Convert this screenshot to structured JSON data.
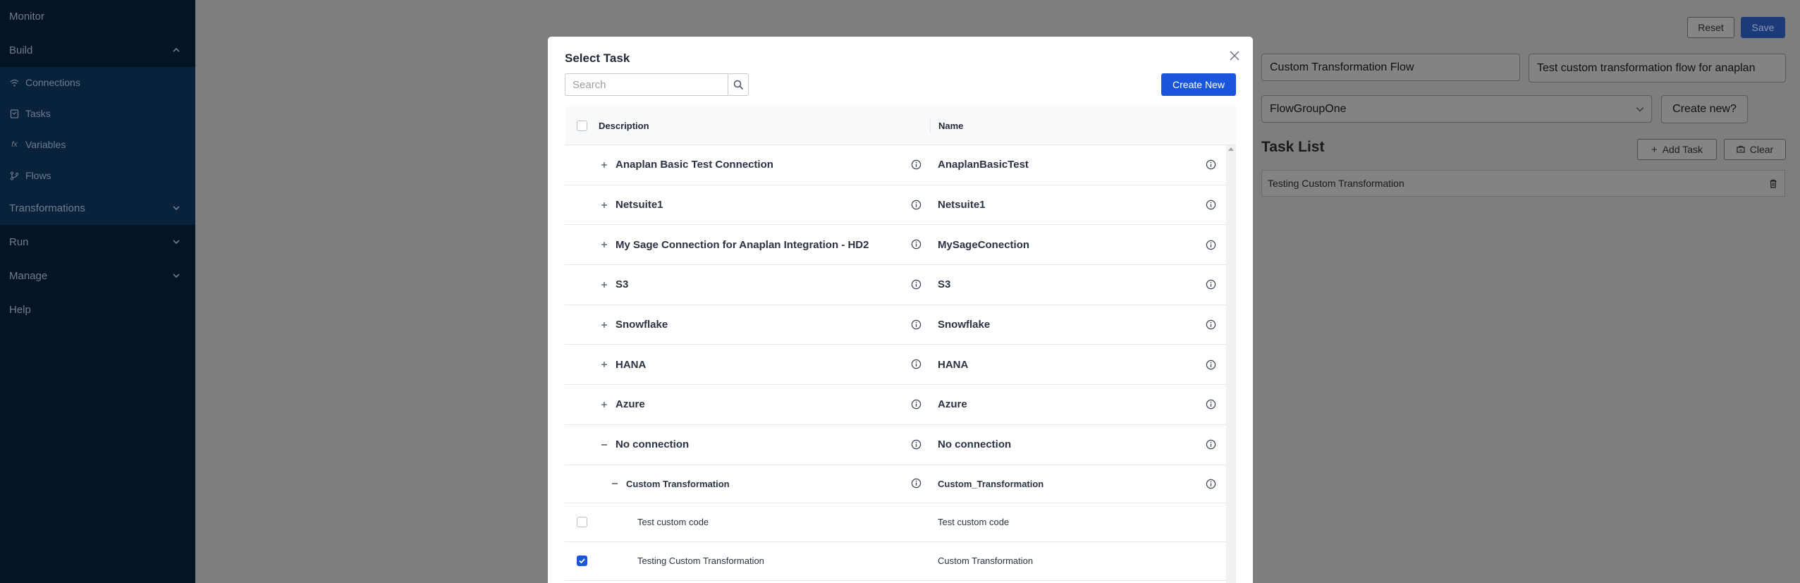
{
  "sidebar": {
    "monitor": "Monitor",
    "build": "Build",
    "items": [
      {
        "label": "Connections",
        "icon": "wifi-icon"
      },
      {
        "label": "Tasks",
        "icon": "task-icon"
      },
      {
        "label": "Variables",
        "icon": "function-icon"
      },
      {
        "label": "Flows",
        "icon": "branch-icon"
      }
    ],
    "transformations": "Transformations",
    "run": "Run",
    "manage": "Manage",
    "help": "Help"
  },
  "page": {
    "reset_label": "Reset",
    "save_label": "Save",
    "flow_name": "Custom Transformation Flow",
    "flow_description": "Test custom transformation flow for anaplan",
    "flow_group": "FlowGroupOne",
    "create_new_label": "Create new?",
    "task_list_title": "Task List",
    "add_task_label": "Add Task",
    "clear_label": "Clear",
    "task_list_items": [
      "Testing Custom Transformation"
    ]
  },
  "modal": {
    "title": "Select Task",
    "search_placeholder": "Search",
    "create_new_label": "Create New",
    "columns": {
      "description": "Description",
      "name": "Name"
    },
    "groups": [
      {
        "description": "Anaplan Basic Test Connection",
        "name": "AnaplanBasicTest",
        "expanded": false
      },
      {
        "description": "Netsuite1",
        "name": "Netsuite1",
        "expanded": false
      },
      {
        "description": "My Sage Connection for Anaplan Integration - HD2",
        "name": "MySageConection",
        "expanded": false
      },
      {
        "description": "S3",
        "name": "S3",
        "expanded": false
      },
      {
        "description": "Snowflake",
        "name": "Snowflake",
        "expanded": false
      },
      {
        "description": "HANA",
        "name": "HANA",
        "expanded": false
      },
      {
        "description": "Azure",
        "name": "Azure",
        "expanded": false
      },
      {
        "description": "No connection",
        "name": "No connection",
        "expanded": true
      }
    ],
    "subgroup": {
      "description": "Custom Transformation",
      "name": "Custom_Transformation"
    },
    "tasks": [
      {
        "description": "Test custom code",
        "name": "Test custom code",
        "checked": false
      },
      {
        "description": "Testing Custom Transformation",
        "name": "Custom Transformation",
        "checked": true
      }
    ]
  },
  "colors": {
    "primary": "#1a56db",
    "sidebar": "#031525",
    "overlay": "#7e7e7e"
  }
}
